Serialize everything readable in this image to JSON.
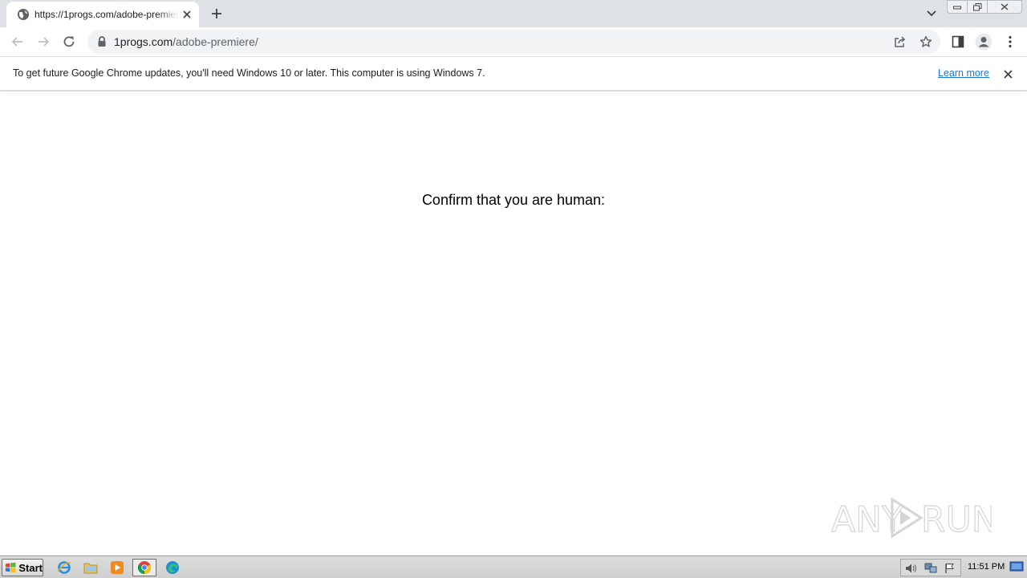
{
  "browser": {
    "tab": {
      "title": "https://1progs.com/adobe-premiere/",
      "favicon": "globe-icon"
    },
    "address_bar": {
      "host": "1progs.com",
      "path": "/adobe-premiere/"
    },
    "infobar": {
      "message": "To get future Google Chrome updates, you'll need Windows 10 or later. This computer is using Windows 7.",
      "link": "Learn more"
    }
  },
  "page": {
    "headline": "Confirm that you are human:"
  },
  "watermark": {
    "text_left": "ANY",
    "text_right": "RUN"
  },
  "taskbar": {
    "start_label": "Start",
    "pinned": [
      "internet-explorer-icon",
      "file-explorer-icon",
      "media-player-icon",
      "chrome-icon",
      "edge-icon"
    ],
    "clock": "11:51 PM"
  },
  "colors": {
    "tabstrip_bg": "#dee1e6",
    "omnibox_bg": "#f1f3f4",
    "link": "#1a73e8",
    "taskbar_bg": "#d4d4d4"
  }
}
